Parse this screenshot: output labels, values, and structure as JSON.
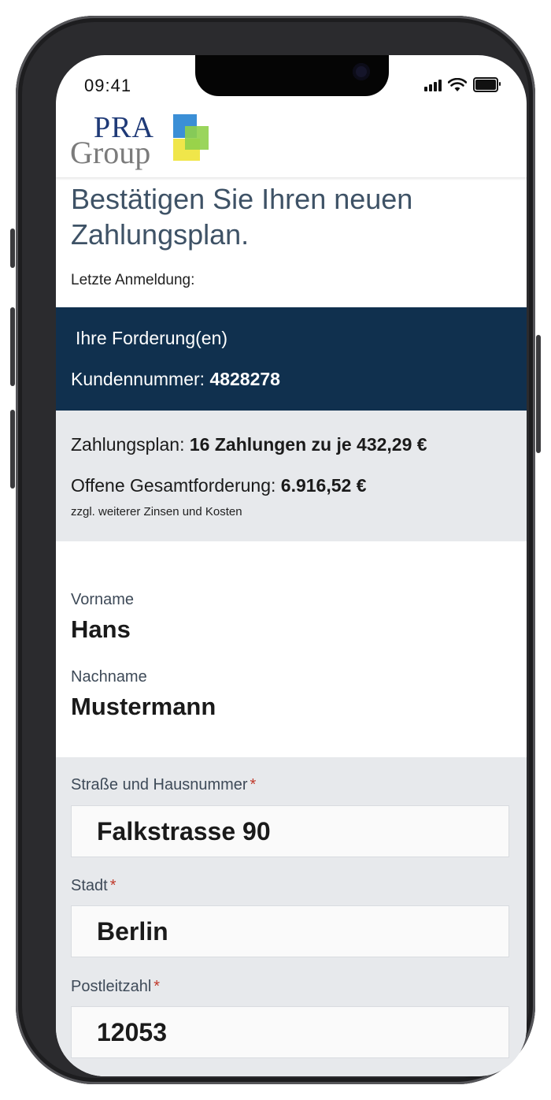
{
  "status_bar": {
    "time": "09:41"
  },
  "logo": {
    "line1": "PRA",
    "line2": "Group",
    "colors": [
      "#3b8fd6",
      "#8fd04a",
      "#f0e64a"
    ]
  },
  "page": {
    "title": "Bestätigen Sie Ihren neuen Zahlungsplan.",
    "last_login_label": "Letzte Anmeldung:"
  },
  "claims": {
    "title": "Ihre Forderung(en)",
    "customer_number_label": "Kundennummer:",
    "customer_number": "4828278"
  },
  "plan": {
    "plan_label": "Zahlungsplan:",
    "plan_value": "16 Zahlungen zu je 432,29 €",
    "total_label": "Offene Gesamtforderung:",
    "total_value": "6.916,52 €",
    "note": "zzgl. weiterer Zinsen und Kosten"
  },
  "person": {
    "first_name_label": "Vorname",
    "first_name": "Hans",
    "last_name_label": "Nachname",
    "last_name": "Mustermann"
  },
  "address": {
    "street_label": "Straße und Hausnummer",
    "street": "Falkstrasse 90",
    "city_label": "Stadt",
    "city": "Berlin",
    "zip_label": "Postleitzahl",
    "zip": "12053",
    "required_marker": "*"
  },
  "colors": {
    "primary_navy": "#10304e",
    "panel_grey": "#e7e9ec",
    "title_color": "#3e5266",
    "required_red": "#c0392b"
  }
}
